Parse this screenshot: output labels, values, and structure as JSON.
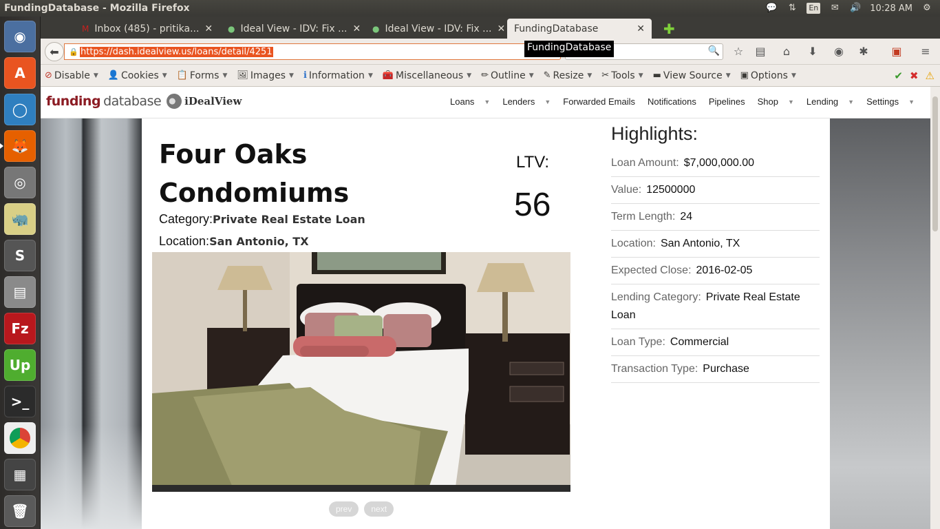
{
  "window_title": "FundingDatabase - Mozilla Firefox",
  "indicators": {
    "keyboard": "En",
    "clock": "10:28 AM"
  },
  "tabs": [
    {
      "title": "Inbox (485) - pritika...",
      "icon": "gmail-icon"
    },
    {
      "title": "Ideal View - IDV: Fix ...",
      "icon": "idv-icon"
    },
    {
      "title": "Ideal View - IDV: Fix ...",
      "icon": "idv-icon"
    },
    {
      "title": "FundingDatabase",
      "icon": "none"
    }
  ],
  "url": "https://dash.idealview.us/loans/detail/4251",
  "tooltip": "FundingDatabase",
  "dev_toolbar": [
    "Disable",
    "Cookies",
    "Forms",
    "Images",
    "Information",
    "Miscellaneous",
    "Outline",
    "Resize",
    "Tools",
    "View Source",
    "Options"
  ],
  "site": {
    "logo": {
      "funding": "funding",
      "database": "database",
      "brand": "iDealView"
    },
    "nav": [
      "Loans",
      "Lenders",
      "Forwarded Emails",
      "Notifications",
      "Pipelines",
      "Shop",
      "Lending",
      "Settings"
    ],
    "nav_dropdowns": {
      "Loans": true,
      "Lenders": true,
      "Shop": true,
      "Lending": true,
      "Settings": true
    }
  },
  "loan": {
    "title_line1": "Four Oaks",
    "title_line2": "Condomiums",
    "category_label": "Category:",
    "category": "Private Real Estate Loan",
    "location_label": "Location:",
    "location": "San Antonio, TX",
    "ltv_label": "LTV:",
    "ltv": "56",
    "pager": {
      "prev": "prev",
      "next": "next"
    }
  },
  "highlights": {
    "title": "Highlights:",
    "rows": [
      {
        "k": "Loan Amount:",
        "v": "$7,000,000.00"
      },
      {
        "k": "Value:",
        "v": "12500000"
      },
      {
        "k": "Term Length:",
        "v": "24"
      },
      {
        "k": "Location:",
        "v": "San Antonio, TX"
      },
      {
        "k": "Expected Close:",
        "v": "2016-02-05"
      },
      {
        "k": "Lending Category:",
        "v": "Private Real Estate Loan"
      },
      {
        "k": "Loan Type:",
        "v": "Commercial"
      },
      {
        "k": "Transaction Type:",
        "v": "Purchase"
      }
    ]
  },
  "colors": {
    "brand": "#8c1c24",
    "ubuntu_orange": "#e95420",
    "os_bar": "#3c3b37"
  }
}
